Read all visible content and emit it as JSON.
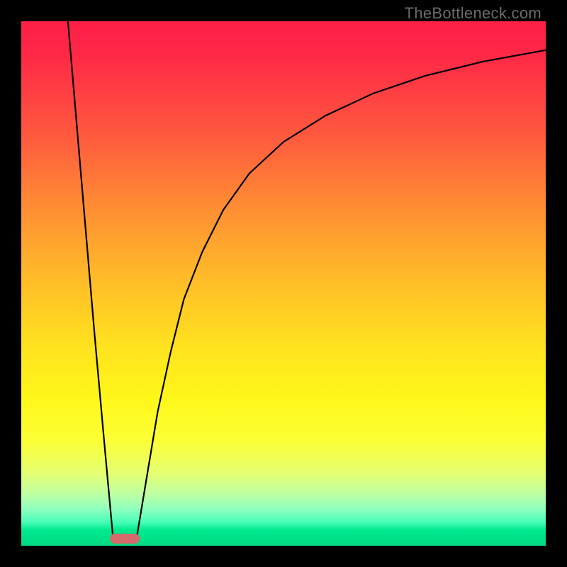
{
  "watermark": {
    "text": "TheBottleneck.com"
  },
  "chart_data": {
    "type": "line",
    "title": "",
    "xlabel": "",
    "ylabel": "",
    "xlim": [
      0,
      100
    ],
    "ylim": [
      0,
      100
    ],
    "grid": false,
    "legend": false,
    "gradient_stops": [
      {
        "pos": 0,
        "color": "#ff1f48"
      },
      {
        "pos": 22,
        "color": "#ff5a3e"
      },
      {
        "pos": 48,
        "color": "#ffb829"
      },
      {
        "pos": 72,
        "color": "#fff71a"
      },
      {
        "pos": 90,
        "color": "#c0ffa0"
      },
      {
        "pos": 100,
        "color": "#00da82"
      }
    ],
    "series": [
      {
        "name": "left-branch",
        "x": [
          8.9,
          10.6,
          12.3,
          14.0,
          15.8,
          17.5
        ],
        "y": [
          100,
          80,
          60,
          40,
          20,
          1.5
        ]
      },
      {
        "name": "right-branch",
        "x": [
          22.0,
          24.0,
          26.0,
          28.5,
          31.0,
          34.5,
          38.5,
          43.5,
          50.0,
          58.0,
          67.0,
          77.0,
          88.0,
          100.0
        ],
        "y": [
          1.5,
          13.5,
          25.5,
          37.0,
          47.0,
          56.0,
          64.0,
          71.0,
          77.0,
          82.0,
          86.2,
          89.6,
          92.3,
          94.5
        ]
      }
    ],
    "marker": {
      "x_center_pct": 19.7,
      "y_center_pct": 1.4,
      "color": "#d46a6a"
    }
  }
}
